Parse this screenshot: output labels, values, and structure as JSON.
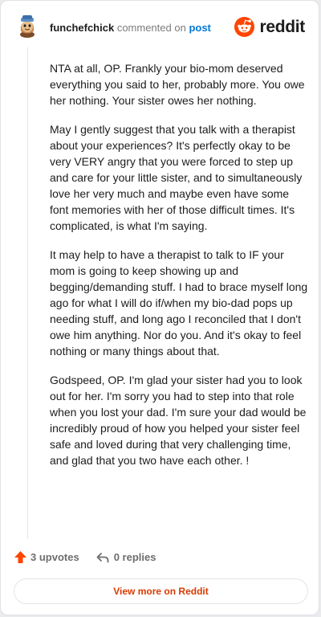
{
  "header": {
    "username": "funchefchick",
    "action_text": "commented on",
    "target_link": "post",
    "brand_name": "reddit"
  },
  "comment": {
    "paragraphs": [
      "NTA at all, OP. Frankly your bio-mom deserved everything you said to her, probably more. You owe her nothing. Your sister owes her nothing.",
      "May I gently suggest that you talk with a therapist about your experiences? It's perfectly okay to be very VERY angry that you were forced to step up and care for your little sister, and to simultaneously love her very much and maybe even have some font memories with her of those difficult times. It's complicated, is what I'm saying.",
      "It may help to have a therapist to talk to IF your mom is going to keep showing up and begging/demanding stuff. I had to brace myself long ago for what I will do if/when my bio-dad pops up needing stuff, and long ago I reconciled that I don't owe him anything. Nor do you. And it's okay to feel nothing or many things about that.",
      "Godspeed, OP. I'm glad your sister had you to look out for her. I'm sorry you had to step into that role when you lost your dad. I'm sure your dad would be incredibly proud of how you helped your sister feel safe and loved during that very challenging time, and glad that you two have each other. !"
    ]
  },
  "actions": {
    "upvotes_label": "3 upvotes",
    "replies_label": "0 replies"
  },
  "footer": {
    "view_more_label": "View more on Reddit"
  },
  "icons": {
    "avatar": "avatar-icon",
    "brand": "reddit-logo-icon",
    "upvote": "upvote-arrow-icon",
    "reply": "reply-arrow-icon"
  },
  "colors": {
    "brand_orange": "#ff4500",
    "link_blue": "#0079d3",
    "button_text": "#d93a00",
    "text_primary": "#1c1c1c",
    "text_muted": "#7c7c7c"
  }
}
